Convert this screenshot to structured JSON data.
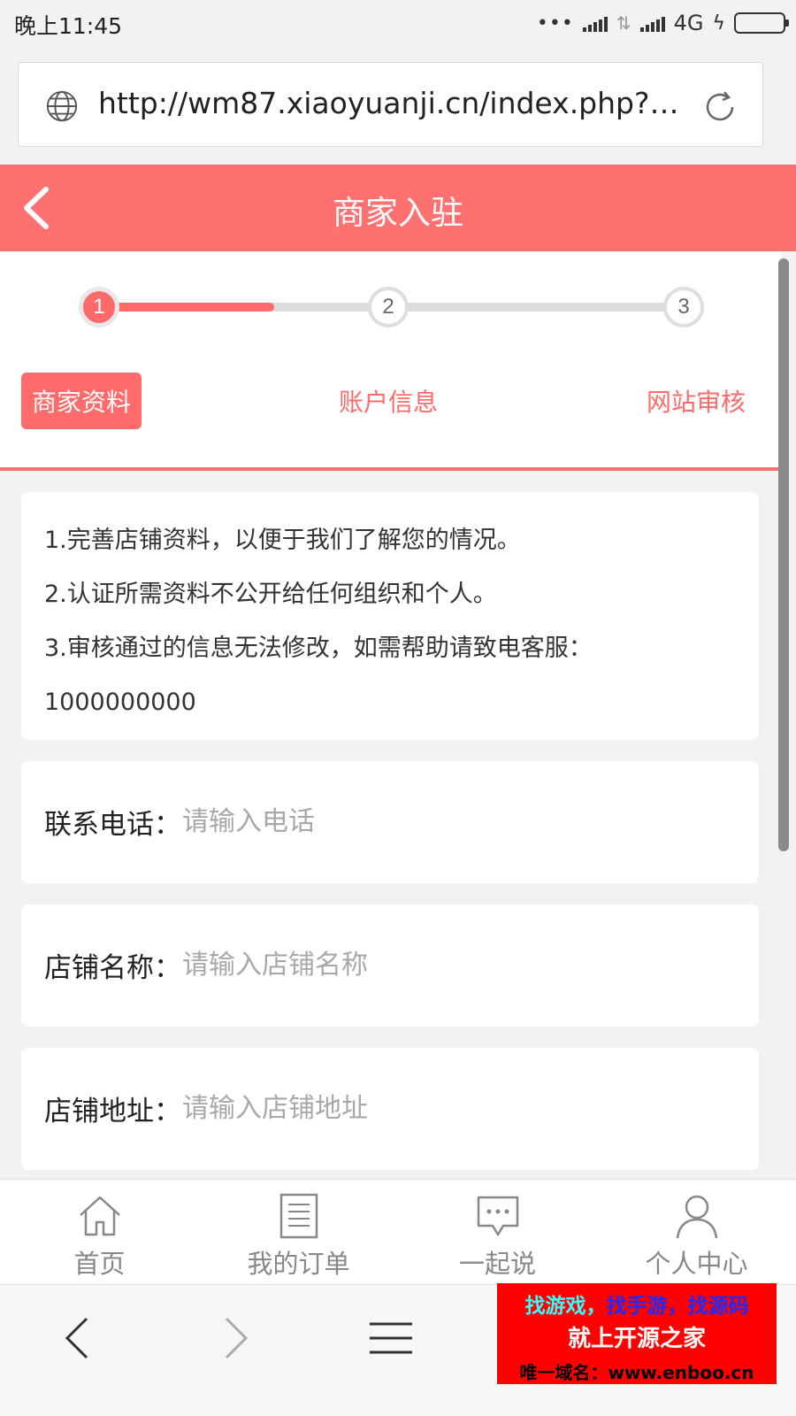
{
  "status_bar": {
    "time": "晚上11:45",
    "dots": "•••",
    "network": "4G",
    "colors": {
      "battery": "#4cd137"
    }
  },
  "browser": {
    "url": "http://wm87.xiaoyuanji.cn/index.php?ctrl...",
    "icons": {
      "left": "globe-icon",
      "right": "refresh-icon"
    }
  },
  "header": {
    "title": "商家入驻",
    "back_icon": "chevron-left-icon",
    "colors": {
      "background": "#ff7070"
    }
  },
  "steps": {
    "progress_fraction": 0.3,
    "items": [
      {
        "number": "1",
        "label": "商家资料",
        "active": true
      },
      {
        "number": "2",
        "label": "账户信息",
        "active": false
      },
      {
        "number": "3",
        "label": "网站审核",
        "active": false
      }
    ]
  },
  "notice": {
    "lines": [
      "1.完善店铺资料，以便于我们了解您的情况。",
      "2.认证所需资料不公开给任何组织和个人。",
      "3.审核通过的信息无法修改，如需帮助请致电客服：",
      "1000000000"
    ]
  },
  "form": {
    "fields": [
      {
        "label": "联系电话：",
        "placeholder": "请输入电话",
        "value": ""
      },
      {
        "label": "店铺名称：",
        "placeholder": "请输入店铺名称",
        "value": ""
      },
      {
        "label": "店铺地址：",
        "placeholder": "请输入店铺地址",
        "value": ""
      }
    ]
  },
  "tab_bar": {
    "items": [
      {
        "label": "首页",
        "icon": "home-icon"
      },
      {
        "label": "我的订单",
        "icon": "order-list-icon"
      },
      {
        "label": "一起说",
        "icon": "chat-bubble-icon"
      },
      {
        "label": "个人中心",
        "icon": "user-icon"
      }
    ]
  },
  "browser_nav": {
    "icons": [
      "back-arrow-icon",
      "forward-arrow-icon",
      "menu-icon"
    ]
  },
  "watermark": {
    "line1_a": "找游戏，",
    "line1_b": "找手游，找源码",
    "line2": "就上开源之家",
    "line3": "唯一域名：www.enboo.cn"
  }
}
